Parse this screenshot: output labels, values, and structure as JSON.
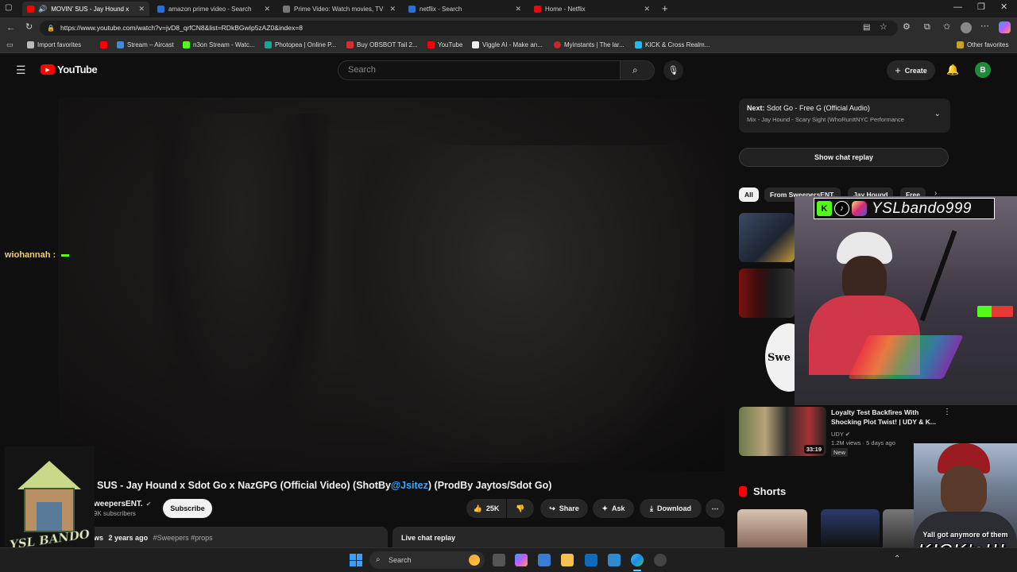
{
  "browser": {
    "tabs": [
      {
        "title": "MOVIN' SUS - Jay Hound x S",
        "color": "#ff0000",
        "active": true
      },
      {
        "title": "amazon prime video - Search",
        "color": "#2b6fd6"
      },
      {
        "title": "Prime Video: Watch movies, TV sh",
        "color": "#777777"
      },
      {
        "title": "netflix - Search",
        "color": "#2b6fd6"
      },
      {
        "title": "Home - Netflix",
        "color": "#e50914"
      }
    ],
    "url": "https://www.youtube.com/watch?v=jvD8_qrfCN8&list=RDkBGwIp5zAZ0&index=8",
    "bookmarks": [
      {
        "label": "Import favorites",
        "color": "#bbbbbb"
      },
      {
        "label": "",
        "color": "#ff0000"
      },
      {
        "label": "Stream – Aircast",
        "color": "#3d8bd9"
      },
      {
        "label": "n3on Stream - Watc...",
        "color": "#53fc18"
      },
      {
        "label": "Photopea | Online P...",
        "color": "#18a497"
      },
      {
        "label": "Buy OBSBOT Tail 2...",
        "color": "#d32f2f"
      },
      {
        "label": "YouTube",
        "color": "#ff0000"
      },
      {
        "label": "Viggle AI - Make an...",
        "color": "#eeeeee"
      },
      {
        "label": "Myinstants | The lar...",
        "color": "#c62828"
      },
      {
        "label": "KICK & Cross Realm...",
        "color": "#29b6f6"
      }
    ],
    "other_favorites": "Other favorites"
  },
  "youtube": {
    "logo": "YouTube",
    "search_placeholder": "Search",
    "create_label": "Create",
    "avatar_letter": "B",
    "video_title_prefix": "SUS - Jay Hound x Sdot Go x NazGPG (Official Video) (ShotBy",
    "video_title_mention": "@Jsitez",
    "video_title_suffix": ") (ProdBy Jaytos/Sdot Go)",
    "channel_name": "weepersENT.",
    "subscribers": "9K subscribers",
    "subscribe_label": "Subscribe",
    "likes": "25K",
    "share_label": "Share",
    "ask_label": "Ask",
    "download_label": "Download",
    "meta_views": "ws",
    "meta_date": "2 years ago",
    "meta_tags": "#Sweepers #props",
    "live_chat_replay": "Live chat replay",
    "next_label": "Next:",
    "next_title": "Sdot Go - Free G (Official Audio)",
    "mix_label": "Mix - Jay Hound - Scary Sight (WhoRunItNYC Performance",
    "show_chat_replay": "Show chat replay",
    "chips": [
      "All",
      "From SweepersENT.",
      "Jay Hound",
      "Free"
    ],
    "rec_title_line1": "Loyalty Test Backfires With",
    "rec_title_line2": "Shocking Plot Twist! | UDY & K...",
    "rec_channel": "UDY",
    "rec_meta": "1.2M views · 5 days ago",
    "rec_badge": "New",
    "rec_duration": "33:19",
    "shorts_label": "Shorts"
  },
  "overlay": {
    "chat_user": "wiohannah :",
    "streamer_handle": "YSLbando999",
    "bando_logo_text": "YSL BANDO",
    "caption_line1": "Yall got anymore of them",
    "caption_line2": "KICK's!!!"
  },
  "taskbar": {
    "search_label": "Search"
  }
}
